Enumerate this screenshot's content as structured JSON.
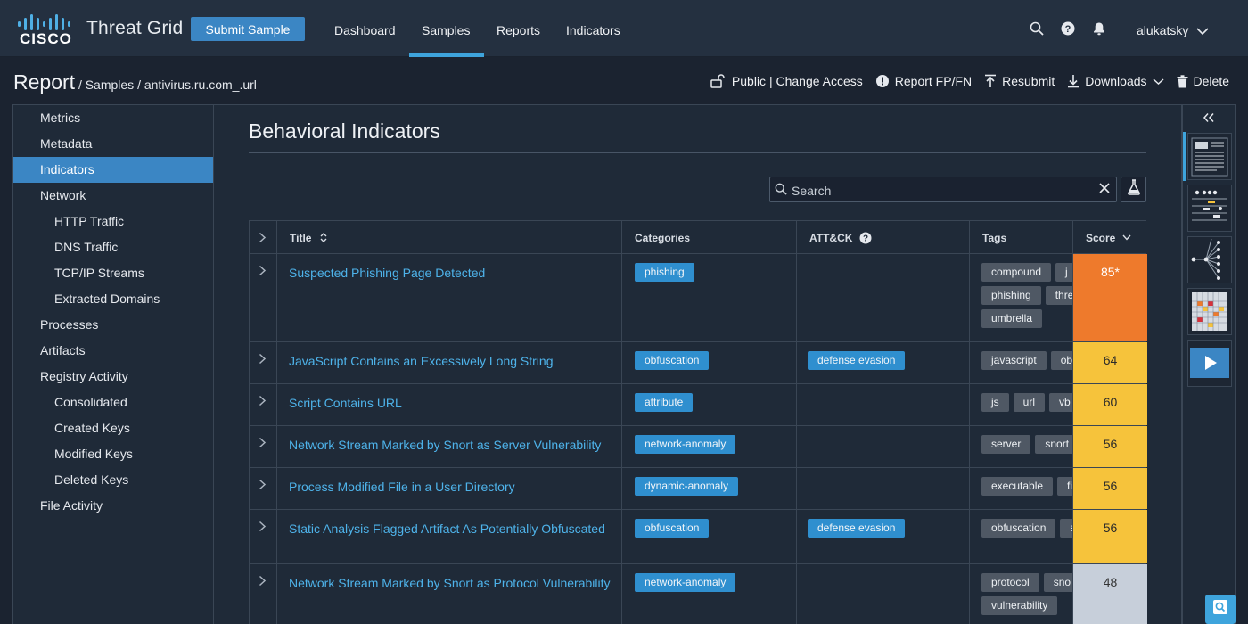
{
  "brand": {
    "logo_text": "CISCO",
    "app_title": "Threat Grid",
    "submit_label": "Submit Sample"
  },
  "nav": [
    "Dashboard",
    "Samples",
    "Reports",
    "Indicators"
  ],
  "nav_active": "Samples",
  "user": "alukatsky",
  "breadcrumb": {
    "root": "Report",
    "path": "/ Samples / antivirus.ru.com_.url"
  },
  "actions": {
    "access": "Public | Change Access",
    "report_fp": "Report FP/FN",
    "resubmit": "Resubmit",
    "downloads": "Downloads",
    "delete": "Delete"
  },
  "sidebar": [
    {
      "label": "Metrics",
      "sub": false
    },
    {
      "label": "Metadata",
      "sub": false
    },
    {
      "label": "Indicators",
      "sub": false,
      "active": true
    },
    {
      "label": "Network",
      "sub": false
    },
    {
      "label": "HTTP Traffic",
      "sub": true
    },
    {
      "label": "DNS Traffic",
      "sub": true
    },
    {
      "label": "TCP/IP Streams",
      "sub": true
    },
    {
      "label": "Extracted Domains",
      "sub": true
    },
    {
      "label": "Processes",
      "sub": false
    },
    {
      "label": "Artifacts",
      "sub": false
    },
    {
      "label": "Registry Activity",
      "sub": false
    },
    {
      "label": "Consolidated",
      "sub": true
    },
    {
      "label": "Created Keys",
      "sub": true
    },
    {
      "label": "Modified Keys",
      "sub": true
    },
    {
      "label": "Deleted Keys",
      "sub": true
    },
    {
      "label": "File Activity",
      "sub": false
    }
  ],
  "main": {
    "title": "Behavioral Indicators",
    "search_placeholder": "Search"
  },
  "table": {
    "headers": {
      "title": "Title",
      "categories": "Categories",
      "attck": "ATT&CK",
      "tags": "Tags",
      "score": "Score"
    },
    "rows": [
      {
        "title": "Suspected Phishing Page Detected",
        "category": "phishing",
        "attck": "",
        "tags": [
          "compound",
          "j",
          "phishing",
          "thre",
          "umbrella"
        ],
        "score": "85*",
        "level": "orange"
      },
      {
        "title": "JavaScript Contains an Excessively Long String",
        "category": "obfuscation",
        "attck": "defense evasion",
        "tags": [
          "javascript",
          "ob"
        ],
        "score": "64",
        "level": "yellow"
      },
      {
        "title": "Script Contains URL",
        "category": "attribute",
        "attck": "",
        "tags": [
          "js",
          "url",
          "vb"
        ],
        "score": "60",
        "level": "yellow"
      },
      {
        "title": "Network Stream Marked by Snort as Server Vulnerability",
        "category": "network-anomaly",
        "attck": "",
        "tags": [
          "server",
          "snort"
        ],
        "score": "56",
        "level": "yellow"
      },
      {
        "title": "Process Modified File in a User Directory",
        "category": "dynamic-anomaly",
        "attck": "",
        "tags": [
          "executable",
          "fi"
        ],
        "score": "56",
        "level": "yellow"
      },
      {
        "title": "Static Analysis Flagged Artifact As Potentially Obfuscated",
        "category": "obfuscation",
        "attck": "defense evasion",
        "tags": [
          "obfuscation",
          "s"
        ],
        "score": "56",
        "level": "yellow"
      },
      {
        "title": "Network Stream Marked by Snort as Protocol Vulnerability",
        "category": "network-anomaly",
        "attck": "",
        "tags": [
          "protocol",
          "sno",
          "vulnerability"
        ],
        "score": "48",
        "level": "gray"
      }
    ]
  },
  "colors": {
    "accent": "#3b86c4",
    "link": "#4eb3ea",
    "orange": "#ee7a2c",
    "yellow": "#f6c33b",
    "gray": "#c7cfda"
  },
  "icons": [
    "search-icon",
    "help-icon",
    "bell-icon",
    "chevron-down-icon",
    "unlock-icon",
    "alert-icon",
    "upload-icon",
    "download-icon",
    "trash-icon",
    "flask-icon",
    "close-icon",
    "double-chevron-left-icon",
    "play-icon"
  ]
}
